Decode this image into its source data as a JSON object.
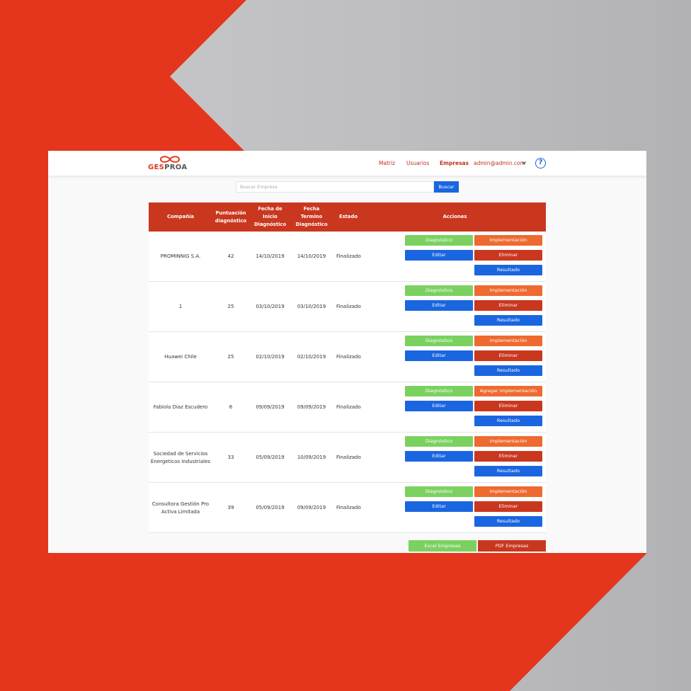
{
  "colors": {
    "brand_red": "#e4361d",
    "header_red": "#c9371f",
    "green": "#7bd160",
    "orange": "#ee6a30",
    "blue": "#1a66e0",
    "background_gray": "#c4c4c6"
  },
  "logo": {
    "part1": "GES",
    "part2": "PROA"
  },
  "nav": {
    "items": [
      {
        "label": "Matriz"
      },
      {
        "label": "Usuarios"
      },
      {
        "label": "Empresas",
        "active": true
      }
    ],
    "user": "admin@admin.com",
    "user_icon": "chevron-down-icon",
    "help_icon": "help-circle-icon",
    "help_glyph": "?"
  },
  "search": {
    "placeholder": "Buscar Empresa",
    "button": "Buscar"
  },
  "table": {
    "headers": {
      "company": "Compañía",
      "score": "Puntuación diagnóstico",
      "start": "Fecha de Inicio Diagnóstico",
      "end": "Fecha Termino Diagnóstico",
      "status": "Estado",
      "actions": "Acciones"
    },
    "rows": [
      {
        "company": "PROMINNIG S.A.",
        "score": "42",
        "start": "14/10/2019",
        "end": "14/10/2019",
        "status": "Finalizado",
        "diagnostico": "Diagnóstico",
        "implementacion": "Implementación",
        "editar": "Editar",
        "eliminar": "Eliminar",
        "resultado": "Resultado"
      },
      {
        "company": "1",
        "score": "25",
        "start": "03/10/2019",
        "end": "03/10/2019",
        "status": "Finalizado",
        "diagnostico": "Diagnóstico",
        "implementacion": "Implementación",
        "editar": "Editar",
        "eliminar": "Eliminar",
        "resultado": "Resultado"
      },
      {
        "company": "Huawei Chile",
        "score": "25",
        "start": "02/10/2019",
        "end": "02/10/2019",
        "status": "Finalizado",
        "diagnostico": "Diagnóstico",
        "implementacion": "Implementación",
        "editar": "Editar",
        "eliminar": "Eliminar",
        "resultado": "Resultado"
      },
      {
        "company": "Fabiola Diaz Escudero",
        "score": "6",
        "start": "09/09/2019",
        "end": "09/09/2019",
        "status": "Finalizado",
        "diagnostico": "Diagnóstico",
        "implementacion": "Agregar implementación",
        "editar": "Editar",
        "eliminar": "Eliminar",
        "resultado": "Resultado"
      },
      {
        "company": "Sociedad de Servicios Energeticos Industriales",
        "score": "33",
        "start": "05/09/2019",
        "end": "10/09/2019",
        "status": "Finalizado",
        "diagnostico": "Diagnóstico",
        "implementacion": "Implementación",
        "editar": "Editar",
        "eliminar": "Eliminar",
        "resultado": "Resultado"
      },
      {
        "company": "Consultora Gestión Pro Activa Limitada",
        "score": "39",
        "start": "05/09/2019",
        "end": "09/09/2019",
        "status": "Finalizado",
        "diagnostico": "Diagnóstico",
        "implementacion": "Implementación",
        "editar": "Editar",
        "eliminar": "Eliminar",
        "resultado": "Resultado"
      }
    ]
  },
  "footer": {
    "excel": "Excel Empresas",
    "pdf": "PDF Empresas"
  }
}
